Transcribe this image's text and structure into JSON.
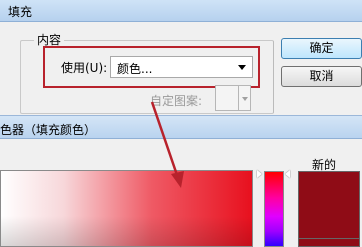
{
  "fill_dialog": {
    "title": "填充",
    "group_title": "内容",
    "use_label": "使用(U):",
    "use_value": "颜色...",
    "custom_pattern_label": "自定图案:",
    "ok_label": "确定",
    "cancel_label": "取消"
  },
  "color_picker": {
    "title": "色器（填充颜色）",
    "new_label": "新的",
    "new_color": "#8f0c16",
    "current_color": "#8f0c16"
  },
  "annotation": {
    "color": "#b8222c"
  }
}
